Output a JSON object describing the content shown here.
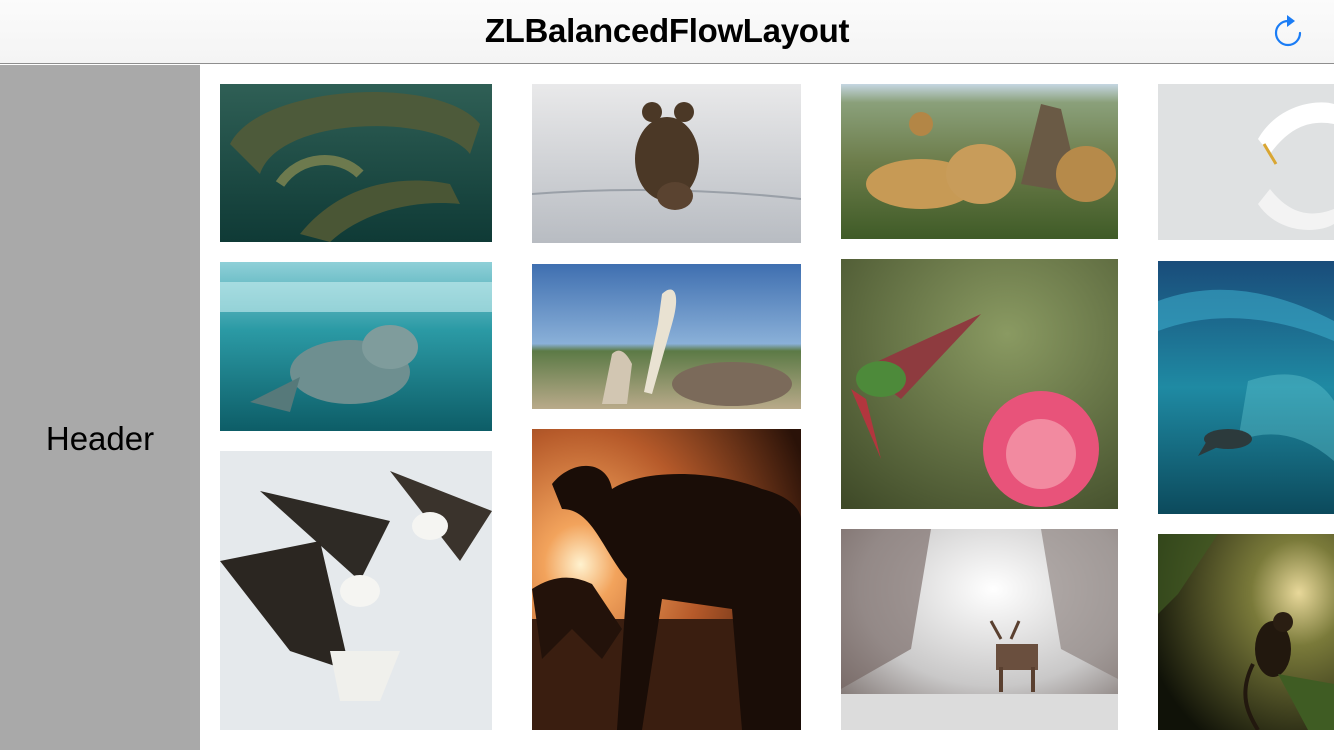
{
  "navbar": {
    "title": "ZLBalancedFlowLayout",
    "refresh_icon": "refresh-icon",
    "accent_color": "#1a7cf5"
  },
  "header": {
    "label": "Header",
    "background": "#a9a9a9"
  },
  "photos": [
    {
      "subject": "crocodile",
      "icon": "crocodile-photo"
    },
    {
      "subject": "walrus",
      "icon": "walrus-photo"
    },
    {
      "subject": "bald eagles",
      "icon": "eagles-photo"
    },
    {
      "subject": "bear with cub",
      "icon": "bear-photo"
    },
    {
      "subject": "pelican",
      "icon": "pelican-photo"
    },
    {
      "subject": "camel at sunset",
      "icon": "camel-photo"
    },
    {
      "subject": "cheetahs",
      "icon": "cheetahs-photo"
    },
    {
      "subject": "hummingbird",
      "icon": "hummingbird-photo"
    },
    {
      "subject": "deer in frost",
      "icon": "deer-photo"
    },
    {
      "subject": "egret",
      "icon": "egret-photo"
    },
    {
      "subject": "sea lion underwater",
      "icon": "sealion-photo"
    },
    {
      "subject": "monkey in forest",
      "icon": "monkey-photo"
    }
  ]
}
